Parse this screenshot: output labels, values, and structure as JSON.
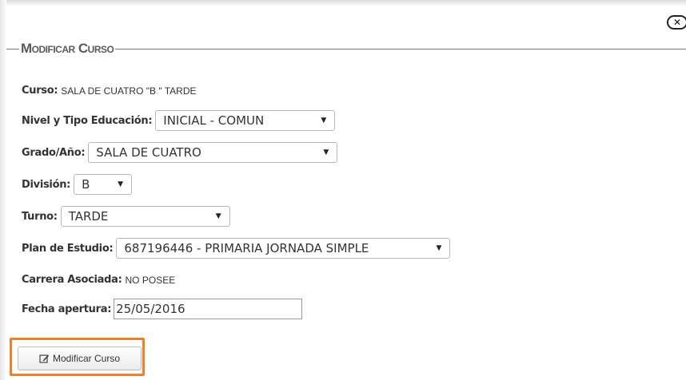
{
  "dialog": {
    "close_icon": "close-icon",
    "legend_title": "Modificar Curso"
  },
  "form": {
    "curso_label": "Curso:",
    "curso_value": "SALA DE CUATRO \"B \" TARDE",
    "nivel_label": "Nivel y Tipo Educación:",
    "nivel_value": "INICIAL - COMUN",
    "grado_label": "Grado/Año:",
    "grado_value": "SALA DE CUATRO",
    "division_label": "División:",
    "division_value": "B",
    "turno_label": "Turno:",
    "turno_value": "TARDE",
    "plan_label": "Plan de Estudio:",
    "plan_value": "687196446 - PRIMARIA JORNADA SIMPLE",
    "carrera_label": "Carrera Asociada:",
    "carrera_value": "NO POSEE",
    "fecha_label": "Fecha apertura:",
    "fecha_value": "25/05/2016"
  },
  "actions": {
    "submit_label": "Modificar Curso",
    "submit_icon": "edit-icon",
    "highlight_color": "#e8832a"
  }
}
